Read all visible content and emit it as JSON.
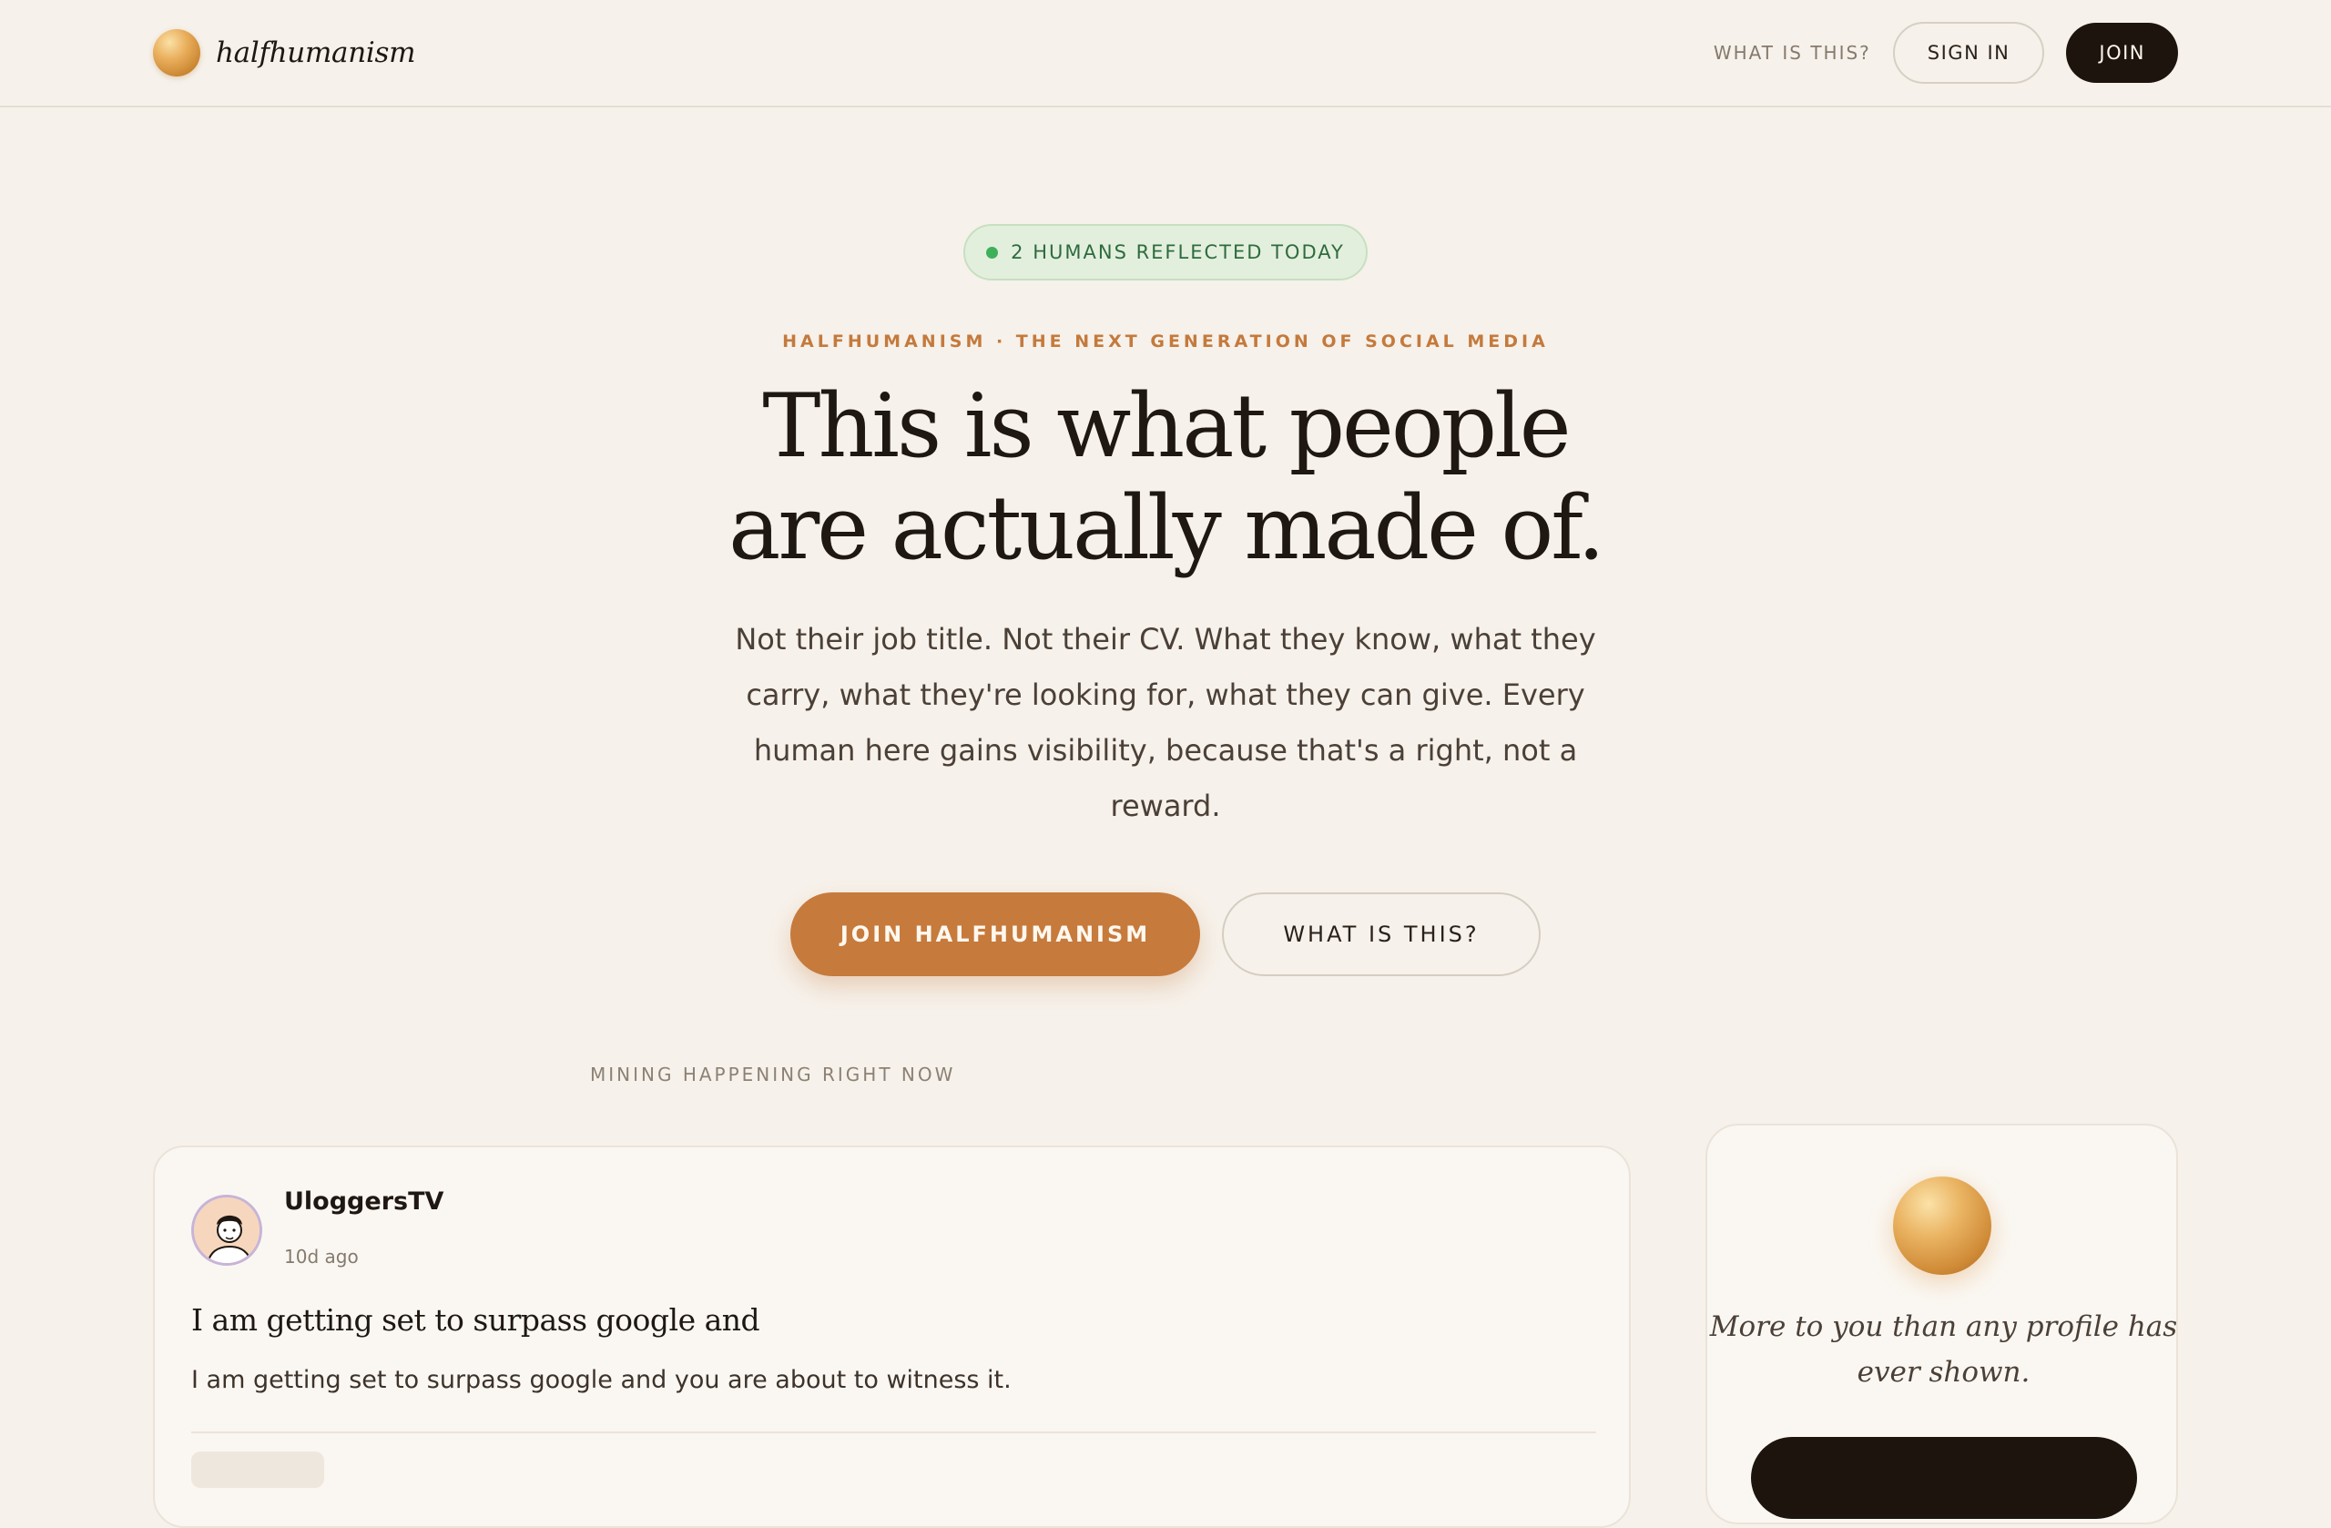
{
  "header": {
    "brand": "halfhumanism",
    "nav_what": "WHAT IS THIS?",
    "signin_label": "SIGN IN",
    "join_label": "JOIN"
  },
  "hero": {
    "status": "2 HUMANS REFLECTED TODAY",
    "eyebrow": "HALFHUMANISM · THE NEXT GENERATION OF SOCIAL MEDIA",
    "headline_line1": "This is what people",
    "headline_line2": "are actually made of.",
    "subcopy": "Not their job title. Not their CV. What they know, what they carry, what they're looking for, what they can give. Every human here gains visibility, because that's a right, not a reward.",
    "cta_primary": "JOIN HALFHUMANISM",
    "cta_secondary": "WHAT IS THIS?"
  },
  "feed": {
    "section_label": "MINING HAPPENING RIGHT NOW",
    "post": {
      "author": "UloggersTV",
      "time": "10d ago",
      "title": "I am getting set to surpass google and",
      "body": "I am getting set to surpass google and you are about to witness it."
    }
  },
  "sidebar": {
    "tagline": "More to you than any profile has ever shown."
  },
  "colors": {
    "background": "#f6f1ea",
    "accent": "#c67a3c",
    "dark": "#1c140d",
    "status_green": "#3fb05a"
  }
}
